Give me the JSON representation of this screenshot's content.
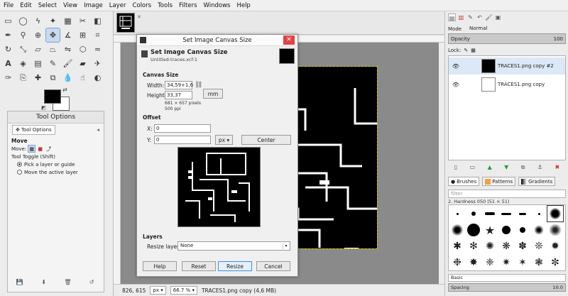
{
  "menu": [
    "File",
    "Edit",
    "Select",
    "View",
    "Image",
    "Layer",
    "Colors",
    "Tools",
    "Filters",
    "Windows",
    "Help"
  ],
  "tools": [
    "rect-select-icon",
    "ellipse-select-icon",
    "free-select-icon",
    "fuzzy-select-icon",
    "color-select-icon",
    "scissors-icon",
    "foreground-select-icon",
    "paths-icon",
    "color-picker-icon",
    "zoom-icon",
    "measure-icon",
    "move-icon",
    "align-icon",
    "crop-icon",
    "rotate-icon",
    "scale-icon",
    "shear-icon",
    "perspective-icon",
    "flip-icon",
    "cage-icon",
    "warp-icon",
    "text-icon",
    "bucket-fill-icon",
    "blend-icon",
    "pencil-icon",
    "paintbrush-icon",
    "eraser-icon",
    "airbrush-icon",
    "ink-icon",
    "clone-icon",
    "heal-icon",
    "perspective-clone-icon",
    "blur-icon",
    "smudge-icon",
    "dodge-burn-icon"
  ],
  "tool_options": {
    "title": "Tool Options",
    "tab_label": "Tool Options",
    "heading": "Move",
    "move_label": "Move:",
    "toggle_label": "Tool Toggle  (Shift)",
    "option1": "Pick a layer or guide",
    "option2": "Move the active layer"
  },
  "dialog": {
    "window_title": "Set Image Canvas Size",
    "heading": "Set Image Canvas Size",
    "subheading": "Untitled-traces.xcf-1",
    "canvas_size": "Canvas Size",
    "width_label": "Width:",
    "width_value": "34,59+1,6",
    "height_label": "Height:",
    "height_value": "33,37",
    "unit": "mm",
    "pixels_text": "681 × 657 pixels",
    "ppi_text": "500 ppi",
    "offset": "Offset",
    "x_label": "X:",
    "x_value": "0",
    "y_label": "Y:",
    "y_value": "0",
    "offset_unit": "px",
    "center_label": "Center",
    "layers": "Layers",
    "resize_layers_label": "Resize layers:",
    "resize_layers_value": "None",
    "help_label": "Help",
    "reset_label": "Reset",
    "resize_label": "Resize",
    "cancel_label": "Cancel"
  },
  "status": {
    "coords": "826, 615",
    "unit": "px",
    "zoom": "66.7 %",
    "info": "TRACES1.png copy (4,6 MB)"
  },
  "layers_panel": {
    "mode_label": "Mode",
    "mode_value": "Normal",
    "opacity_label": "Opacity",
    "opacity_value": "100",
    "lock_label": "Lock:",
    "layers": [
      {
        "name": "TRACES1.png copy #2",
        "selected": true
      },
      {
        "name": "TRACES1.png copy",
        "selected": false
      }
    ]
  },
  "brushes_panel": {
    "tab_brushes": "Brushes",
    "tab_patterns": "Patterns",
    "tab_gradients": "Gradients",
    "filter_placeholder": "filter",
    "brush_name": "2. Hardness 050 (51 × 51)",
    "preset": "Basic",
    "spacing_label": "Spacing",
    "spacing_value": "10.0"
  },
  "colors": {
    "foreground": "#000000",
    "background": "#ffffff",
    "accent": "#c8daf0",
    "close_button": "#e04343"
  }
}
